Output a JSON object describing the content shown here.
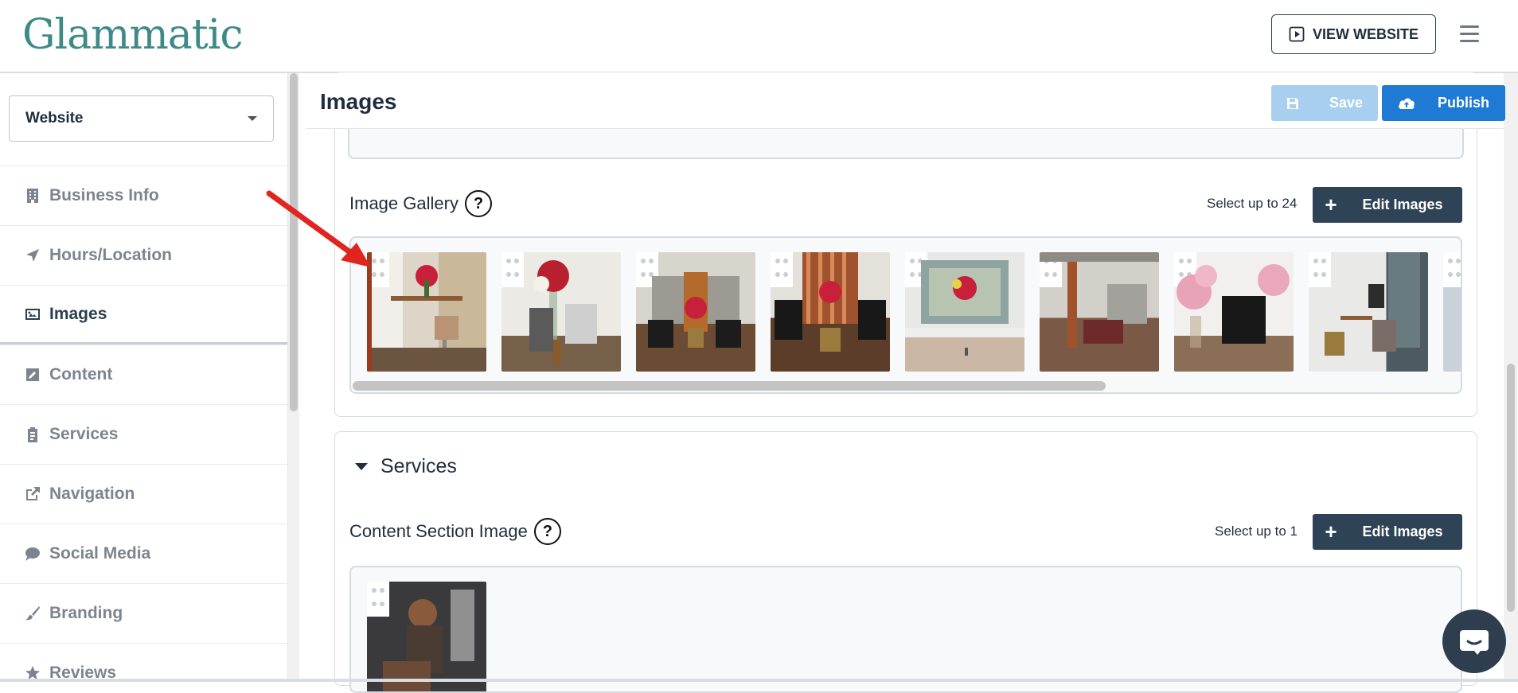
{
  "header": {
    "logo_text": "Glammatic",
    "view_website_label": "VIEW WEBSITE"
  },
  "sidebar": {
    "select_value": "Website",
    "items": [
      {
        "label": "Business Info",
        "icon": "building-icon"
      },
      {
        "label": "Hours/Location",
        "icon": "location-arrow-icon"
      },
      {
        "label": "Images",
        "icon": "image-icon",
        "active": true
      },
      {
        "label": "Content",
        "icon": "edit-icon"
      },
      {
        "label": "Services",
        "icon": "clipboard-icon"
      },
      {
        "label": "Navigation",
        "icon": "external-link-icon"
      },
      {
        "label": "Social Media",
        "icon": "comment-icon"
      },
      {
        "label": "Branding",
        "icon": "paint-brush-icon"
      },
      {
        "label": "Reviews",
        "icon": "star-icon"
      }
    ]
  },
  "main": {
    "title": "Images",
    "save_label": "Save",
    "publish_label": "Publish",
    "gallery": {
      "label": "Image Gallery",
      "help": "?",
      "select_limit": "Select up to 24",
      "edit_label": "Edit Images",
      "image_count_visible": 9
    },
    "services": {
      "title": "Services",
      "content_label": "Content Section Image",
      "help": "?",
      "select_limit": "Select up to 1",
      "edit_label": "Edit Images"
    }
  },
  "colors": {
    "brand": "#3f8a86",
    "publish": "#1f7ad3",
    "save_disabled": "#a9cff0",
    "edit_button": "#2e4356",
    "arrow": "#e0241f"
  }
}
